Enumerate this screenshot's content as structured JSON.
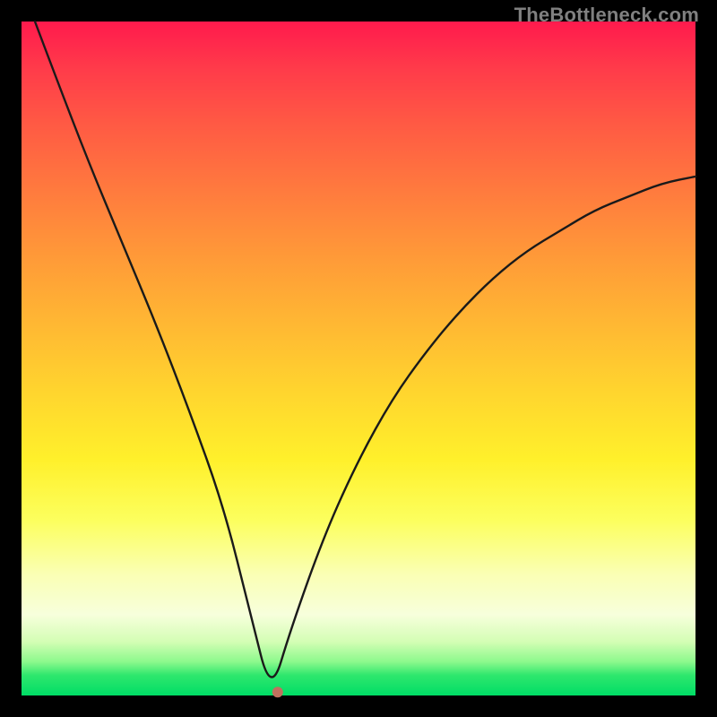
{
  "watermark": "TheBottleneck.com",
  "chart_data": {
    "type": "line",
    "title": "",
    "xlabel": "",
    "ylabel": "",
    "xlim": [
      0,
      100
    ],
    "ylim": [
      0,
      100
    ],
    "grid": false,
    "legend": false,
    "background": "red-to-green vertical gradient (bottleneck heatmap)",
    "description": "V-shaped bottleneck curve: y is high near x=0, drops to ~0 at the vertex, then rises with concave-down shape toward x=100.",
    "vertex_x": 37,
    "vertex_y": 0,
    "marker": {
      "x": 38,
      "y": 0.5,
      "color": "#c0705e"
    },
    "series": [
      {
        "name": "bottleneck-curve",
        "x": [
          2,
          5,
          10,
          15,
          20,
          25,
          30,
          34,
          37,
          40,
          45,
          50,
          55,
          60,
          65,
          70,
          75,
          80,
          85,
          90,
          95,
          100
        ],
        "y": [
          100,
          92,
          79,
          67,
          55,
          42,
          28,
          12,
          0,
          10,
          24,
          35,
          44,
          51,
          57,
          62,
          66,
          69,
          72,
          74,
          76,
          77
        ]
      }
    ]
  }
}
